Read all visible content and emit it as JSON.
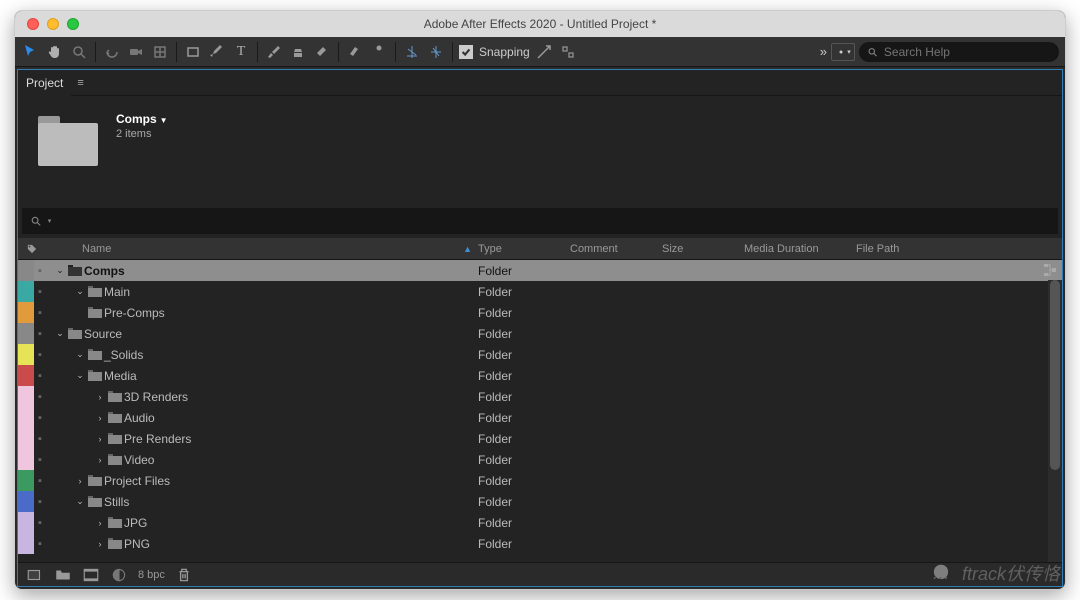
{
  "window": {
    "title": "Adobe After Effects 2020 - Untitled Project *"
  },
  "toolbar": {
    "snapping_label": "Snapping",
    "search_placeholder": "Search Help"
  },
  "panel": {
    "tab_label": "Project",
    "preview_name": "Comps",
    "preview_sub": "2 items",
    "search_value": ""
  },
  "cols": {
    "name": "Name",
    "type": "Type",
    "comment": "Comment",
    "size": "Size",
    "media_duration": "Media Duration",
    "file_path": "File Path"
  },
  "rows": [
    {
      "label_color": "#888888",
      "indent": 0,
      "disclosure": "open",
      "name": "Comps",
      "type": "Folder",
      "selected": true
    },
    {
      "label_color": "#3aa9a3",
      "indent": 1,
      "disclosure": "open",
      "name": "Main",
      "type": "Folder",
      "selected": false
    },
    {
      "label_color": "#e19a3c",
      "indent": 1,
      "disclosure": "none",
      "name": "Pre-Comps",
      "type": "Folder",
      "selected": false
    },
    {
      "label_color": "#888888",
      "indent": 0,
      "disclosure": "open",
      "name": "Source",
      "type": "Folder",
      "selected": false
    },
    {
      "label_color": "#e7e356",
      "indent": 1,
      "disclosure": "open",
      "name": "_Solids",
      "type": "Folder",
      "selected": false
    },
    {
      "label_color": "#c94b4b",
      "indent": 1,
      "disclosure": "open",
      "name": "Media",
      "type": "Folder",
      "selected": false
    },
    {
      "label_color": "#efc6dd",
      "indent": 2,
      "disclosure": "closed",
      "name": "3D Renders",
      "type": "Folder",
      "selected": false
    },
    {
      "label_color": "#efc6dd",
      "indent": 2,
      "disclosure": "closed",
      "name": "Audio",
      "type": "Folder",
      "selected": false
    },
    {
      "label_color": "#efc6dd",
      "indent": 2,
      "disclosure": "closed",
      "name": "Pre Renders",
      "type": "Folder",
      "selected": false
    },
    {
      "label_color": "#efc6dd",
      "indent": 2,
      "disclosure": "closed",
      "name": "Video",
      "type": "Folder",
      "selected": false
    },
    {
      "label_color": "#3a9a5f",
      "indent": 1,
      "disclosure": "closed",
      "name": "Project Files",
      "type": "Folder",
      "selected": false
    },
    {
      "label_color": "#4b6bc9",
      "indent": 1,
      "disclosure": "open",
      "name": "Stills",
      "type": "Folder",
      "selected": false
    },
    {
      "label_color": "#c9b6e0",
      "indent": 2,
      "disclosure": "closed",
      "name": "JPG",
      "type": "Folder",
      "selected": false
    },
    {
      "label_color": "#c9b6e0",
      "indent": 2,
      "disclosure": "closed",
      "name": "PNG",
      "type": "Folder",
      "selected": false
    }
  ],
  "footer": {
    "bpc": "8 bpc"
  },
  "watermark": "ftrack伏传恪"
}
